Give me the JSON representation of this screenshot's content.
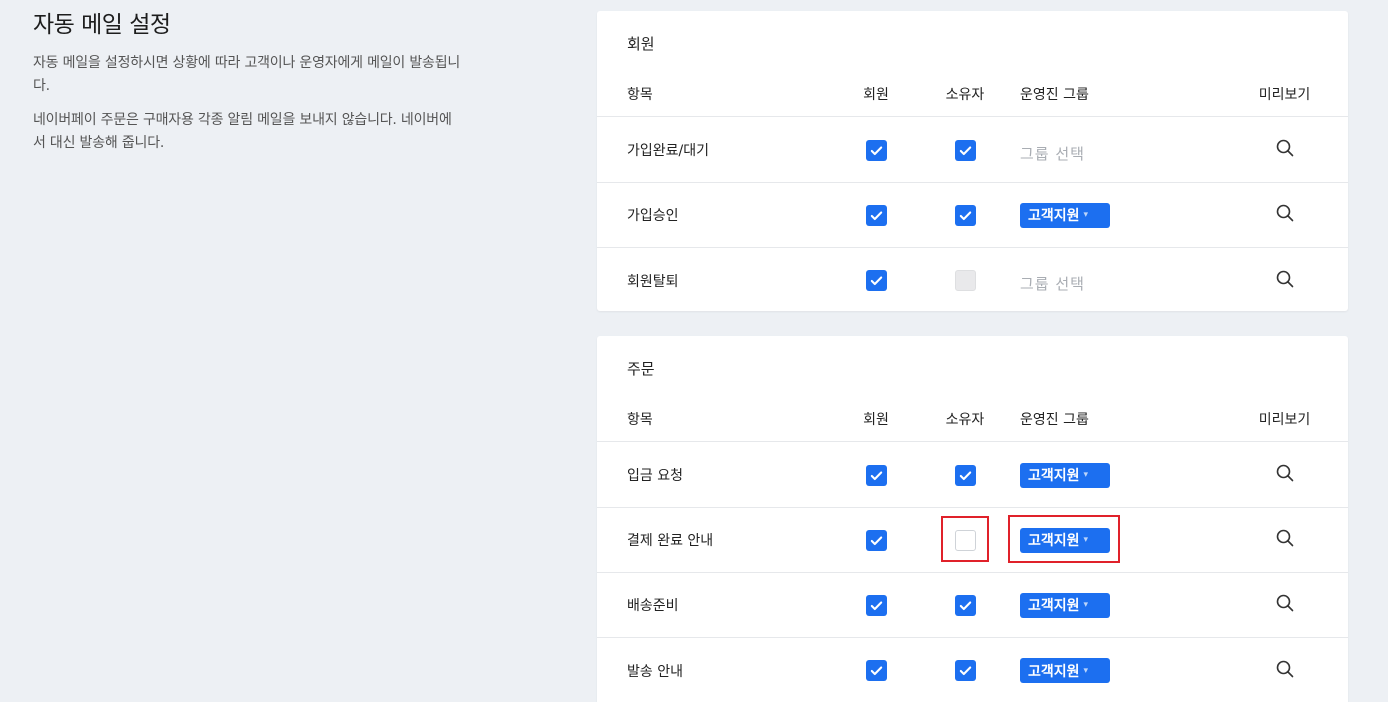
{
  "page": {
    "title": "자동 메일 설정",
    "desc1": "자동 메일을 설정하시면 상황에 따라 고객이나 운영자에게 메일이 발송됩니다.",
    "desc2": "네이버페이 주문은 구매자용 각종 알림 메일을 보내지 않습니다. 네이버에서 대신 발송해 줍니다."
  },
  "columns": {
    "item": "항목",
    "member": "회원",
    "owner": "소유자",
    "group": "운영진 그룹",
    "preview": "미리보기"
  },
  "placeholder_group": "그룹 선택",
  "colors": {
    "accent": "#1c6ff0",
    "highlight": "#e0212a"
  },
  "sections": [
    {
      "title": "회원",
      "rows": [
        {
          "name": "가입완료/대기",
          "member": true,
          "owner": true,
          "owner_disabled": false,
          "group": ""
        },
        {
          "name": "가입승인",
          "member": true,
          "owner": true,
          "owner_disabled": false,
          "group": "고객지원"
        },
        {
          "name": "회원탈퇴",
          "member": true,
          "owner": false,
          "owner_disabled": true,
          "group": ""
        }
      ]
    },
    {
      "title": "주문",
      "rows": [
        {
          "name": "입금 요청",
          "member": true,
          "owner": true,
          "owner_disabled": false,
          "group": "고객지원"
        },
        {
          "name": "결제 완료 안내",
          "member": true,
          "owner": false,
          "owner_disabled": false,
          "group": "고객지원"
        },
        {
          "name": "배송준비",
          "member": true,
          "owner": true,
          "owner_disabled": false,
          "group": "고객지원"
        },
        {
          "name": "발송 안내",
          "member": true,
          "owner": true,
          "owner_disabled": false,
          "group": "고객지원"
        }
      ]
    }
  ]
}
